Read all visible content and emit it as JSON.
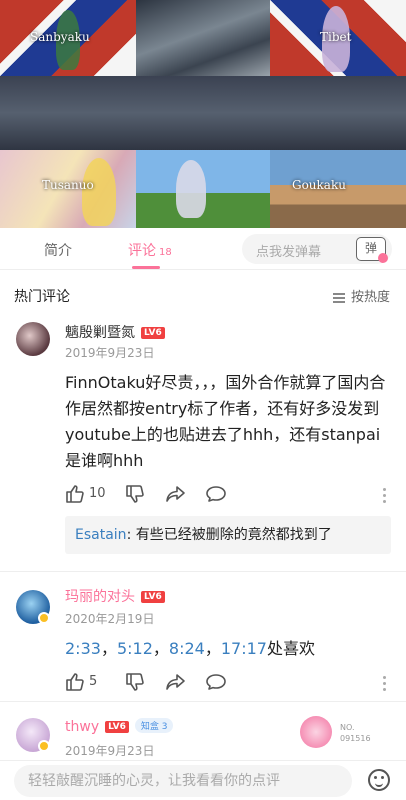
{
  "video": {
    "thumbnails": [
      {
        "label": "Sanbyaku"
      },
      {
        "label": ""
      },
      {
        "label": "Tibet"
      },
      {
        "label": ""
      },
      {
        "label": "Tusanuo"
      },
      {
        "label": ""
      },
      {
        "label": "Goukaku"
      }
    ]
  },
  "tabs": {
    "intro": "简介",
    "comments": "评论",
    "comments_count": "18",
    "danmaku_placeholder": "点我发弹幕",
    "danmaku_button": "弹"
  },
  "hot": {
    "title": "热门评论",
    "sort_label": "按热度"
  },
  "comments": [
    {
      "username": "魑殷剿暨氮",
      "level": "LV6",
      "date": "2019年9月23日",
      "text": "FinnOtaku好尽责，，，国外合作就算了国内合作居然都按entry标了作者，还有好多没发到youtube上的也贴进去了hhh，还有stanpai是谁啊hhh",
      "likes": "10",
      "reply": {
        "user": "Esatain",
        "text": ": 有些已经被删除的竟然都找到了"
      }
    },
    {
      "username": "玛丽的对头",
      "level": "LV6",
      "date": "2020年2月19日",
      "timestamps": [
        "2:33",
        "5:12",
        "8:24",
        "17:17"
      ],
      "text_suffix": "处喜欢",
      "likes": "5"
    },
    {
      "username": "thwy",
      "level": "LV6",
      "fan_badge": "知盒",
      "fan_level": "3",
      "date": "2019年9月23日",
      "no_tag": "NO.\n091516"
    }
  ],
  "bottom": {
    "input_placeholder": "轻轻敲醒沉睡的心灵，让我看看你的点评"
  },
  "colors": {
    "accent": "#fb7299",
    "link": "#3a7fbf",
    "level_badge": "#f04040"
  }
}
